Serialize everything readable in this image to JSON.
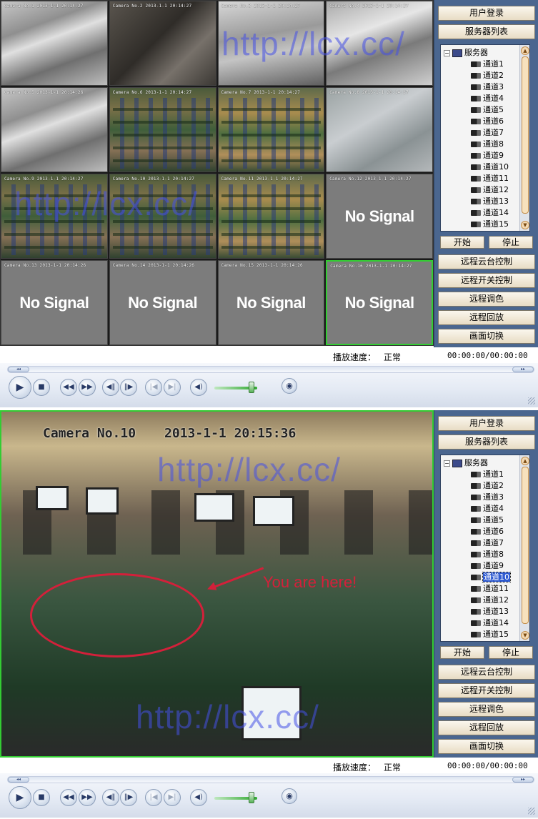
{
  "colors": {
    "panel_bg": "#4a668f",
    "selection_border": "#33cc33",
    "annotation": "#d3203a",
    "watermark": "#4650e6",
    "tree_selected": "#2f5bd1"
  },
  "watermark_text": "http://lcx.cc/",
  "window1": {
    "cameras": [
      {
        "caption": "Camera No.1    2013-1-1 20:14:27",
        "signal": "",
        "view": "stairs"
      },
      {
        "caption": "Camera No.2    2013-1-1 20:14:27",
        "signal": "",
        "view": "dark"
      },
      {
        "caption": "Camera No.3    2013-1-1 20:14:27",
        "signal": "",
        "view": "hall"
      },
      {
        "caption": "Camera No.4    2013-1-1 20:14:27",
        "signal": "",
        "view": "office"
      },
      {
        "caption": "Camera No.5    2013-1-1 20:14:26",
        "signal": "",
        "view": "stairs"
      },
      {
        "caption": "Camera No.6    2013-1-1 20:14:27",
        "signal": "",
        "view": "cafe"
      },
      {
        "caption": "Camera No.7    2013-1-1 20:14:27",
        "signal": "",
        "view": "cafe2"
      },
      {
        "caption": "Camera No.8    2013-1-1 20:14:27",
        "signal": "",
        "view": "bright"
      },
      {
        "caption": "Camera No.9    2013-1-1 20:14:27",
        "signal": "",
        "view": "cafe"
      },
      {
        "caption": "Camera No.10   2013-1-1 20:14:27",
        "signal": "",
        "view": "cafe"
      },
      {
        "caption": "Camera No.11   2013-1-1 20:14:27",
        "signal": "",
        "view": "cafe2"
      },
      {
        "caption": "Camera No.12   2013-1-1 20:14:27",
        "signal": "No Signal",
        "view": "gray"
      },
      {
        "caption": "Camera No.13   2013-1-1 20:14:26",
        "signal": "No Signal",
        "view": "gray"
      },
      {
        "caption": "Camera No.14   2013-1-1 20:14:26",
        "signal": "No Signal",
        "view": "gray"
      },
      {
        "caption": "Camera No.15   2013-1-1 20:14:26",
        "signal": "No Signal",
        "view": "gray"
      },
      {
        "caption": "Camera No.16   2013-1-1 20:14:27",
        "signal": "No Signal",
        "view": "gray"
      }
    ],
    "selected_cell": 16
  },
  "window2": {
    "camera_label": "Camera No.10",
    "timestamp": "2013-1-1 20:15:36",
    "annotation": "You are here!",
    "selected_channel": "通道10"
  },
  "panel": {
    "user_login": "用户登录",
    "server_list": "服务器列表",
    "tree_root": "服务器",
    "tree_expander": "−",
    "channels": [
      "通道1",
      "通道2",
      "通道3",
      "通道4",
      "通道5",
      "通道6",
      "通道7",
      "通道8",
      "通道9",
      "通道10",
      "通道11",
      "通道12",
      "通道13",
      "通道14",
      "通道15"
    ],
    "start": "开始",
    "stop": "停止",
    "ptz_control": "远程云台控制",
    "switch_control": "远程开关控制",
    "color_adjust": "远程调色",
    "playback": "远程回放",
    "view_switch": "画面切换"
  },
  "status": {
    "speed_label": "播放速度：",
    "speed_value": "正常",
    "time": "00:00:00/00:00:00"
  },
  "player": {
    "icons": [
      "play-icon",
      "stop-icon",
      "rewind-icon",
      "fast-forward-icon",
      "step-back-icon",
      "step-forward-icon",
      "prev-icon",
      "next-icon",
      "volume-icon",
      "snapshot-icon"
    ],
    "glyphs": {
      "play": "▶",
      "stop": "■",
      "rewind": "◀◀",
      "fast_forward": "▶▶",
      "step_back": "◀‖",
      "step_forward": "‖▶",
      "prev": "|◀",
      "next": "▶|",
      "volume": "◀)",
      "snapshot": "◉",
      "seek_left": "◂◂",
      "seek_right": "▸▸",
      "scroll_up": "▲",
      "scroll_down": "▼"
    },
    "volume_level": 0.85
  }
}
